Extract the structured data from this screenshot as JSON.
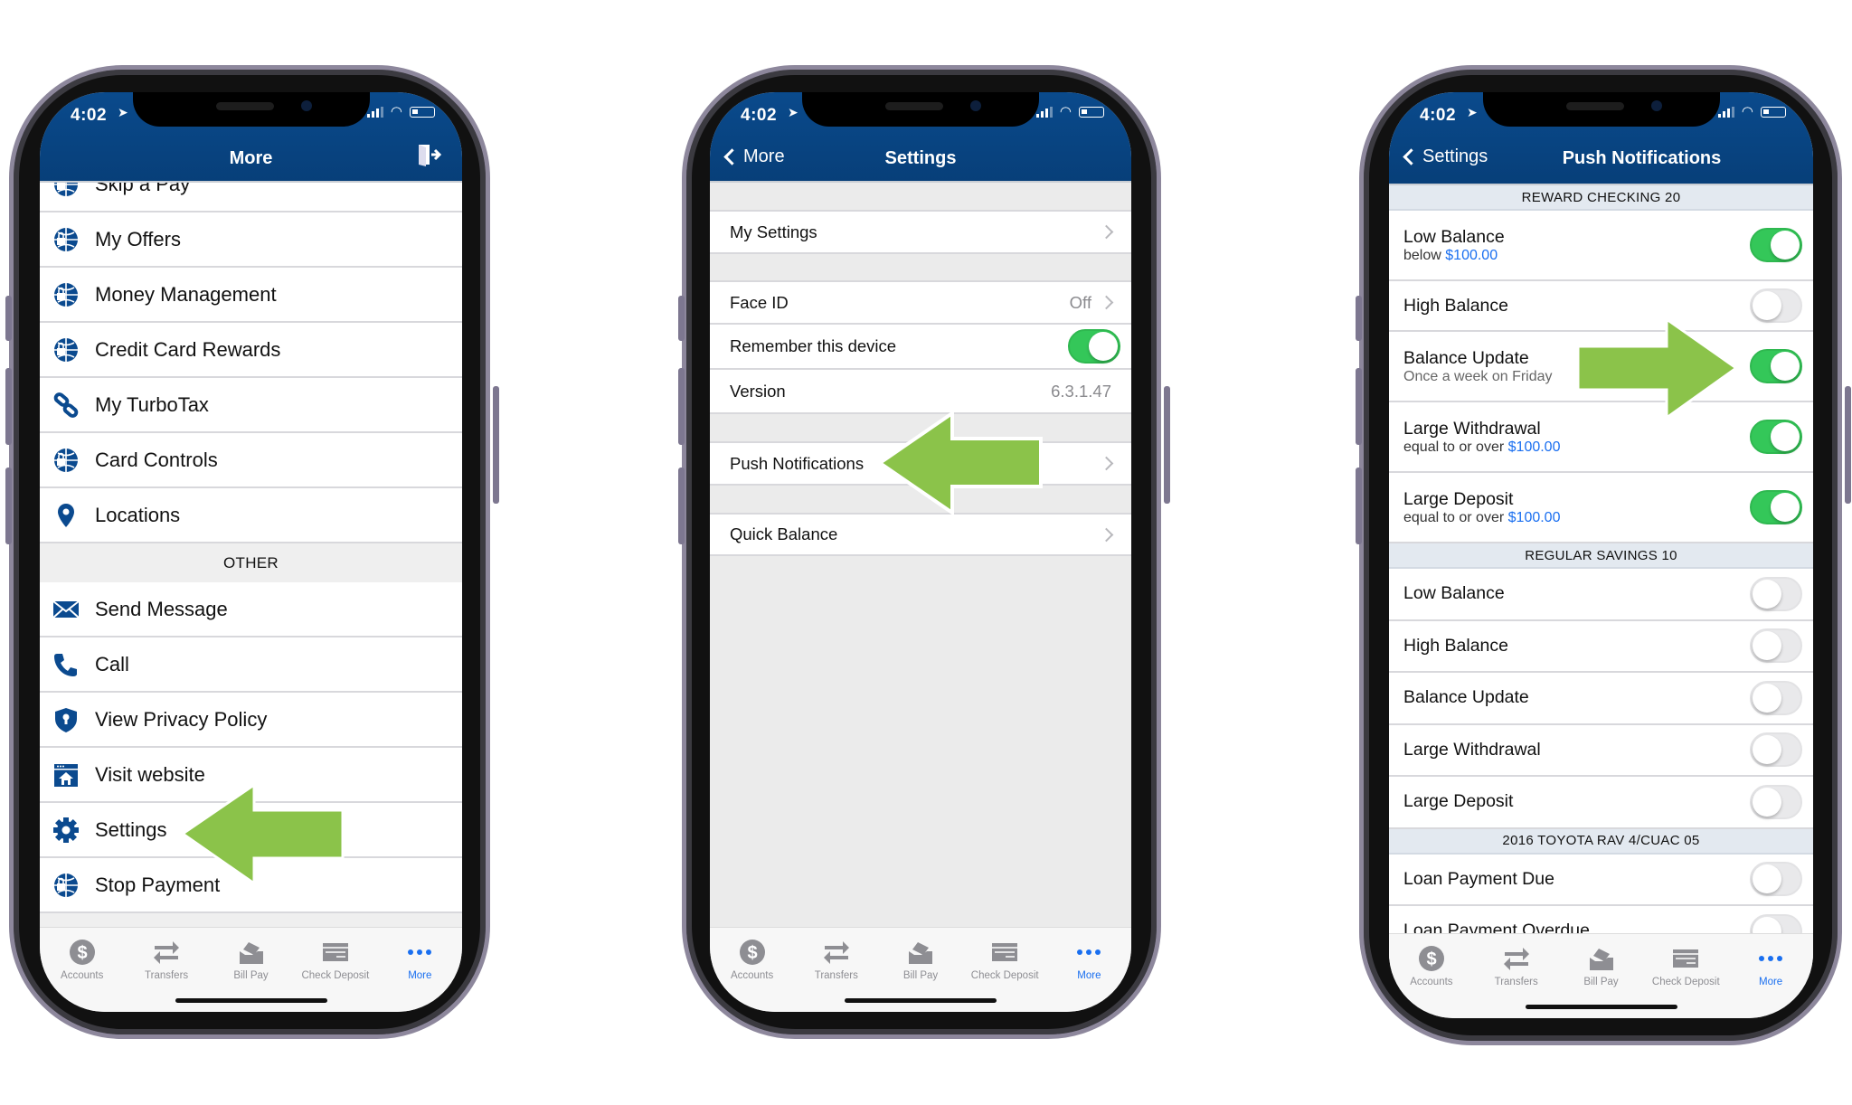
{
  "status_bar": {
    "time": "4:02"
  },
  "tab_bar": {
    "items": [
      {
        "label": "Accounts",
        "icon": "dollar-circle-icon"
      },
      {
        "label": "Transfers",
        "icon": "transfer-arrows-icon"
      },
      {
        "label": "Bill Pay",
        "icon": "bill-pay-icon"
      },
      {
        "label": "Check Deposit",
        "icon": "check-deposit-icon"
      },
      {
        "label": "More",
        "icon": "more-dots-icon",
        "active": true
      }
    ]
  },
  "colors": {
    "header": "#0a4a8c",
    "accent": "#1a6ff0",
    "toggle_on": "#34c759",
    "arrow": "#8bc34a"
  },
  "more_screen": {
    "title": "More",
    "items_top": [
      {
        "label": "Skip a Pay",
        "icon": "globe-lock-icon"
      },
      {
        "label": "My Offers",
        "icon": "globe-lock-icon"
      },
      {
        "label": "Money Management",
        "icon": "globe-lock-icon"
      },
      {
        "label": "Credit Card Rewards",
        "icon": "globe-lock-icon"
      },
      {
        "label": "My TurboTax",
        "icon": "link-icon"
      },
      {
        "label": "Card Controls",
        "icon": "globe-lock-icon"
      },
      {
        "label": "Locations",
        "icon": "location-pin-icon"
      }
    ],
    "other_header": "OTHER",
    "items_other": [
      {
        "label": "Send Message",
        "icon": "envelope-icon"
      },
      {
        "label": "Call",
        "icon": "phone-icon"
      },
      {
        "label": "View Privacy Policy",
        "icon": "shield-keyhole-icon"
      },
      {
        "label": "Visit website",
        "icon": "website-home-icon"
      },
      {
        "label": "Settings",
        "icon": "gear-icon"
      },
      {
        "label": "Stop Payment",
        "icon": "globe-lock-icon"
      }
    ]
  },
  "settings_screen": {
    "back": "More",
    "title": "Settings",
    "rows": [
      {
        "label": "My Settings",
        "chevron": true
      },
      {
        "label": "Face ID",
        "value": "Off",
        "chevron": true
      },
      {
        "label": "Remember this device",
        "toggle": true
      },
      {
        "label": "Version",
        "value": "6.3.1.47"
      },
      {
        "label": "Push Notifications",
        "chevron": true
      },
      {
        "label": "Quick Balance",
        "chevron": true
      }
    ]
  },
  "push_screen": {
    "back": "Settings",
    "title": "Push Notifications",
    "sections": [
      {
        "header": "REWARD CHECKING 20",
        "rows": [
          {
            "label": "Low Balance",
            "sub": "below",
            "amount": "$100.00",
            "on": true
          },
          {
            "label": "High Balance",
            "on": false
          },
          {
            "label": "Balance Update",
            "sub": "Once a week on Friday",
            "on": true
          },
          {
            "label": "Large Withdrawal",
            "sub": "equal to or over",
            "amount": "$100.00",
            "on": true
          },
          {
            "label": "Large Deposit",
            "sub": "equal to or over",
            "amount": "$100.00",
            "on": true
          }
        ]
      },
      {
        "header": "REGULAR SAVINGS 10",
        "rows": [
          {
            "label": "Low Balance",
            "on": false
          },
          {
            "label": "High Balance",
            "on": false
          },
          {
            "label": "Balance Update",
            "on": false
          },
          {
            "label": "Large Withdrawal",
            "on": false
          },
          {
            "label": "Large Deposit",
            "on": false
          }
        ]
      },
      {
        "header": "2016 TOYOTA RAV 4/CUAC 05",
        "rows": [
          {
            "label": "Loan Payment Due",
            "on": false
          },
          {
            "label": "Loan Payment Overdue",
            "on": false
          }
        ]
      }
    ]
  }
}
